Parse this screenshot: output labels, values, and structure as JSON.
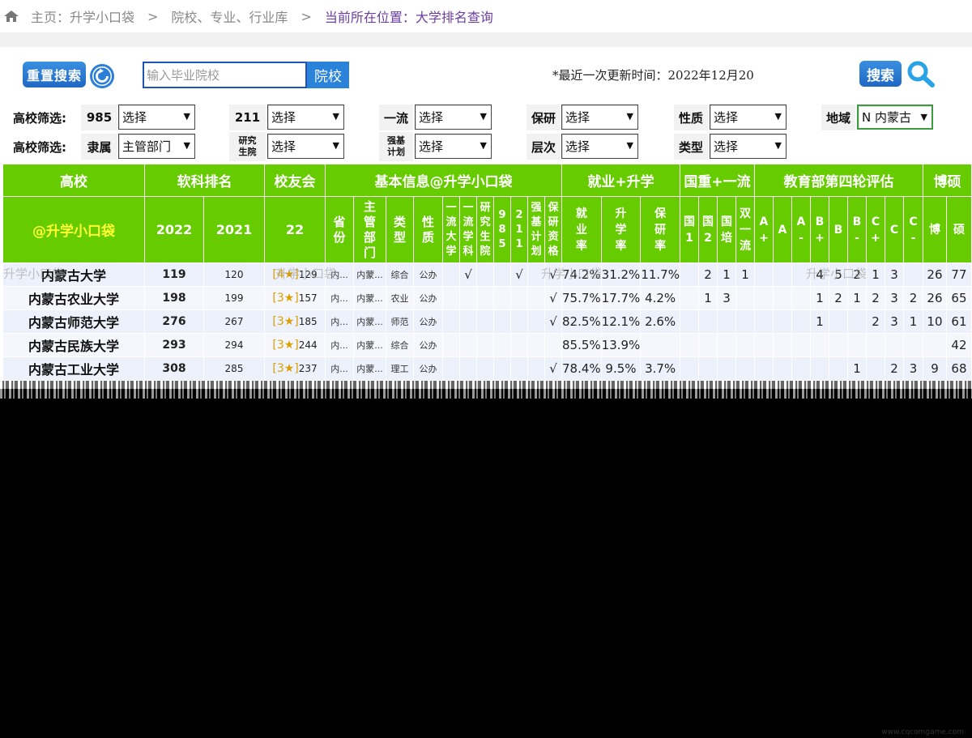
{
  "breadcrumb": {
    "home": "主页：升学小口袋",
    "sep": ">",
    "library": "院校、专业、行业库",
    "current": "当前所在位置：大学排名查询"
  },
  "search": {
    "reset_label": "重置搜索",
    "placeholder": "输入毕业院校",
    "school_button": "院校",
    "update_time": "*最近一次更新时间：2022年12月20",
    "search_label": "搜索"
  },
  "filters": {
    "row1": [
      {
        "label": "高校筛选:",
        "key": "985",
        "value": "选择"
      },
      {
        "key": "211",
        "value": "选择"
      },
      {
        "key": "一流",
        "value": "选择"
      },
      {
        "key": "保研",
        "value": "选择"
      },
      {
        "key": "性质",
        "value": "选择"
      },
      {
        "key": "地域",
        "value": "N 内蒙古"
      }
    ],
    "row2": [
      {
        "label": "高校筛选:",
        "key": "隶属",
        "value": "主管部门"
      },
      {
        "key": "研究生院",
        "key_line1": "研究",
        "key_line2": "生院",
        "value": "选择"
      },
      {
        "key": "强基计划",
        "key_line1": "强基",
        "key_line2": "计划",
        "value": "选择"
      },
      {
        "key": "层次",
        "value": "选择"
      },
      {
        "key": "类型",
        "value": "选择"
      }
    ]
  },
  "table": {
    "group_headers": {
      "school": "高校",
      "soft_rank": "软科排名",
      "alumni": "校友会",
      "basic": "基本信息@升学小口袋",
      "employment": "就业+升学",
      "national": "国重+一流",
      "eval": "教育部第四轮评估",
      "phd_master": "博硕"
    },
    "sub_headers": {
      "brand": "@升学小口袋",
      "y2022": "2022",
      "y2021": "2021",
      "alumni22": "22",
      "province": "省份",
      "dept": "主管部门",
      "type": "类型",
      "nature": "性质",
      "first_univ": "一流大学",
      "first_disc": "一流学科",
      "grad_school": "研究生院",
      "985": "985",
      "211": "211",
      "strong": "强基计划",
      "baoyan_q": "保研资格",
      "emp_rate": "就业率",
      "adv_rate": "升学率",
      "baoyan_rate": "保研率",
      "guo1": "国1",
      "guo2": "国2",
      "guopei": "国培",
      "double": "双一流",
      "grades": [
        "A+",
        "A",
        "A-",
        "B+",
        "B",
        "B-",
        "C+",
        "C",
        "C-"
      ],
      "phd": "博",
      "master": "硕"
    },
    "rows": [
      {
        "name": "内蒙古大学",
        "r2022": "119",
        "r2021": "120",
        "alum_star": "4★",
        "alum": "129",
        "prov": "内...",
        "dept": "内蒙...",
        "type": "综合",
        "nature": "公办",
        "fu": "",
        "fd": "√",
        "gs": "",
        "u985": "",
        "u211": "√",
        "strong": "",
        "bq": "√",
        "emp": "74.2%",
        "adv": "31.2%",
        "bao": "11.7%",
        "g1": "",
        "g2": "2",
        "gp": "1",
        "dbl": "1",
        "grades": [
          "",
          "",
          "",
          "4",
          "5",
          "2",
          "1",
          "3",
          ""
        ],
        "phd": "26",
        "master": "77"
      },
      {
        "name": "内蒙古农业大学",
        "r2022": "198",
        "r2021": "199",
        "alum_star": "3★",
        "alum": "157",
        "prov": "内...",
        "dept": "内蒙...",
        "type": "农业",
        "nature": "公办",
        "fu": "",
        "fd": "",
        "gs": "",
        "u985": "",
        "u211": "",
        "strong": "",
        "bq": "√",
        "emp": "75.7%",
        "adv": "17.7%",
        "bao": "4.2%",
        "g1": "",
        "g2": "1",
        "gp": "3",
        "dbl": "",
        "grades": [
          "",
          "",
          "",
          "1",
          "2",
          "1",
          "2",
          "3",
          "2"
        ],
        "phd": "26",
        "master": "65"
      },
      {
        "name": "内蒙古师范大学",
        "r2022": "276",
        "r2021": "267",
        "alum_star": "3★",
        "alum": "185",
        "prov": "内...",
        "dept": "内蒙...",
        "type": "师范",
        "nature": "公办",
        "fu": "",
        "fd": "",
        "gs": "",
        "u985": "",
        "u211": "",
        "strong": "",
        "bq": "√",
        "emp": "82.5%",
        "adv": "12.1%",
        "bao": "2.6%",
        "g1": "",
        "g2": "",
        "gp": "",
        "dbl": "",
        "grades": [
          "",
          "",
          "",
          "1",
          "",
          "",
          "2",
          "3",
          "1"
        ],
        "phd": "10",
        "master": "61"
      },
      {
        "name": "内蒙古民族大学",
        "r2022": "293",
        "r2021": "294",
        "alum_star": "3★",
        "alum": "244",
        "prov": "内...",
        "dept": "内蒙...",
        "type": "综合",
        "nature": "公办",
        "fu": "",
        "fd": "",
        "gs": "",
        "u985": "",
        "u211": "",
        "strong": "",
        "bq": "",
        "emp": "85.5%",
        "adv": "13.9%",
        "bao": "",
        "g1": "",
        "g2": "",
        "gp": "",
        "dbl": "",
        "grades": [
          "",
          "",
          "",
          "",
          "",
          "",
          "",
          "",
          ""
        ],
        "phd": "",
        "master": "42"
      },
      {
        "name": "内蒙古工业大学",
        "r2022": "308",
        "r2021": "285",
        "alum_star": "3★",
        "alum": "237",
        "prov": "内...",
        "dept": "内蒙...",
        "type": "理工",
        "nature": "公办",
        "fu": "",
        "fd": "",
        "gs": "",
        "u985": "",
        "u211": "",
        "strong": "",
        "bq": "√",
        "emp": "78.4%",
        "adv": "9.5%",
        "bao": "3.7%",
        "g1": "",
        "g2": "",
        "gp": "",
        "dbl": "",
        "grades": [
          "",
          "",
          "",
          "",
          "",
          "1",
          "",
          "2",
          "3"
        ],
        "phd": "9",
        "master": "68"
      }
    ]
  },
  "watermarks": [
    "升学小口袋",
    "升学小口袋",
    "升学小口袋",
    "升学小口袋"
  ],
  "footer_url": "www.cqcomgame.com"
}
